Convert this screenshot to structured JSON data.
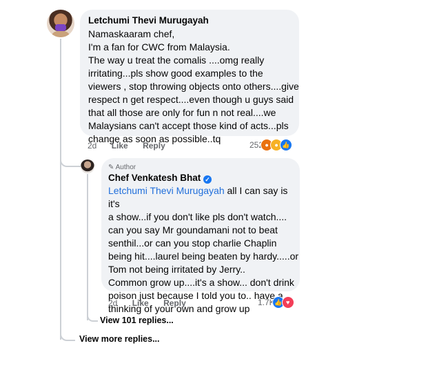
{
  "comment1": {
    "author": "Letchumi Thevi Murugayah",
    "text": "Namaskaaram chef,\nI'm a fan for CWC from Malaysia.\nThe way u treat the comalis ....omg really\nirritating...pls show good examples to the\nviewers , stop throwing objects onto others....give\nrespect n get respect....even though u guys said\nthat all those are only for fun n not real....we\nMalaysians can't accept those kind of acts...pls\nchange as soon as possible..tq",
    "time": "2d",
    "like": "Like",
    "reply": "Reply",
    "reaction_count": "252"
  },
  "reply1": {
    "badge": "Author",
    "author": "Chef Venkatesh Bhat",
    "mention": "Letchumi Thevi Murugayah",
    "text": " all I can say is it's\na show...if you don't like pls don't watch....\ncan you say Mr goundamani not to beat\nsenthil...or can you stop charlie Chaplin\nbeing hit....laurel being beaten by hardy.....or\nTom not being irritated by Jerry..\nCommon grow up....it's  a show... don't drink\npoison just because I told you to.. have a\nthinking of your own and grow up",
    "time": "2d",
    "like": "Like",
    "reply": "Reply",
    "reaction_count": "1.7K"
  },
  "view_replies": "View 101 replies...",
  "view_more_replies": "View more replies...",
  "colors": {
    "accent": "#216fdb",
    "like_blue": "#1877f2",
    "love_red": "#f33e58",
    "angry_orange": "#e9710f",
    "haha_yellow": "#f7b125"
  },
  "icons": [
    "angry-reaction-icon",
    "haha-reaction-icon",
    "like-reaction-icon",
    "love-reaction-icon",
    "verified-badge-icon",
    "pencil-icon"
  ]
}
